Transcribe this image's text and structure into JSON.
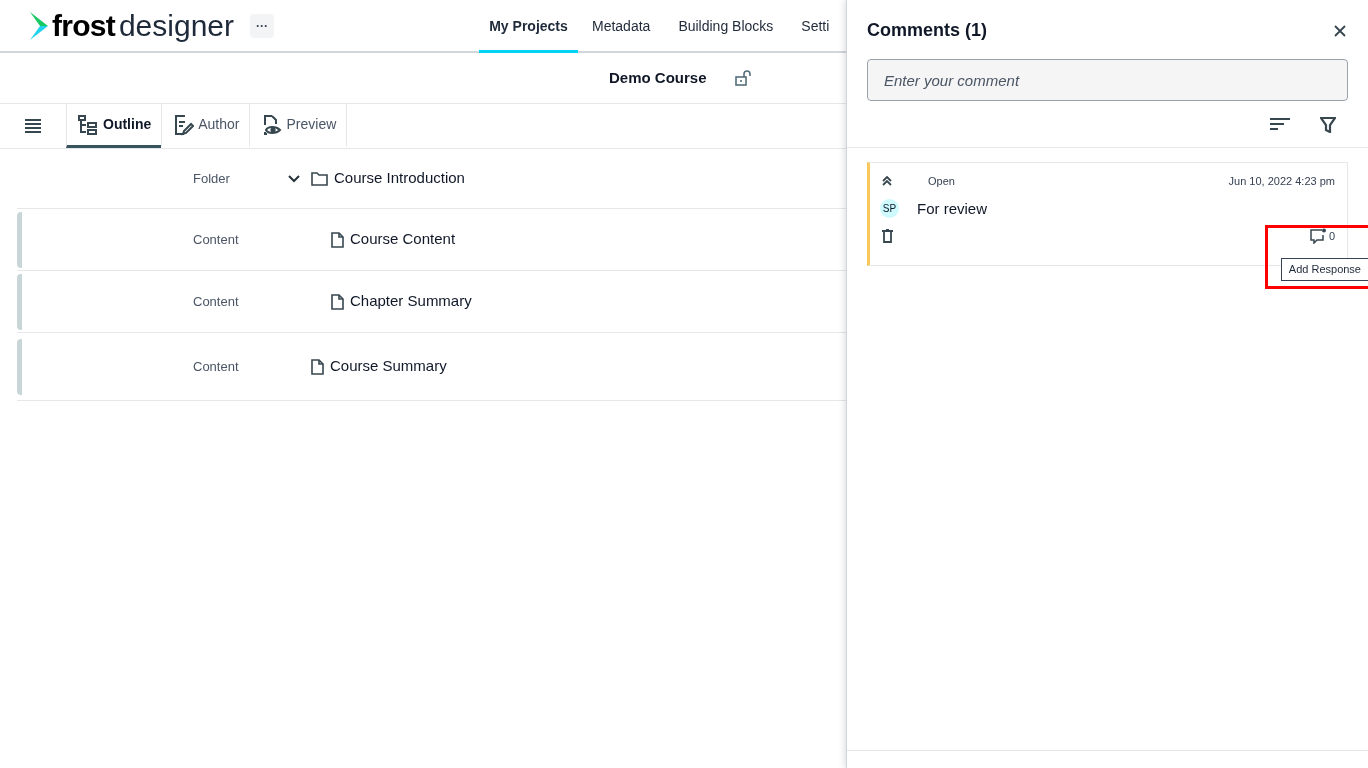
{
  "app": {
    "logo_bold": "frost",
    "logo_light": "designer",
    "more_button": "···"
  },
  "nav": [
    {
      "label": "My Projects",
      "selected": true
    },
    {
      "label": "Metadata",
      "selected": false
    },
    {
      "label": "Building Blocks",
      "selected": false
    },
    {
      "label": "Setti",
      "selected": false
    }
  ],
  "course": {
    "title": "Demo Course",
    "locked": false
  },
  "view_tabs": [
    {
      "label": "Outline",
      "kind": "outline",
      "selected": true
    },
    {
      "label": "Author",
      "kind": "author",
      "selected": false
    },
    {
      "label": "Preview",
      "kind": "preview",
      "selected": false
    }
  ],
  "outline": [
    {
      "type_label": "Folder",
      "name": "Course Introduction",
      "kind": "folder",
      "expanded": true,
      "children": [
        {
          "type_label": "Content",
          "name": "Course Content",
          "kind": "content"
        },
        {
          "type_label": "Content",
          "name": "Chapter Summary",
          "kind": "content"
        }
      ]
    },
    {
      "type_label": "Content",
      "name": "Course Summary",
      "kind": "content"
    }
  ],
  "comments_panel": {
    "title": "Comments (1)",
    "placeholder": "Enter your comment",
    "comments": [
      {
        "status": "Open",
        "date": "Jun 10, 2022 4:23 pm",
        "avatar": "SP",
        "text": "For review",
        "responses": "0",
        "tooltip": "Add Response",
        "highlighted": true
      }
    ]
  }
}
